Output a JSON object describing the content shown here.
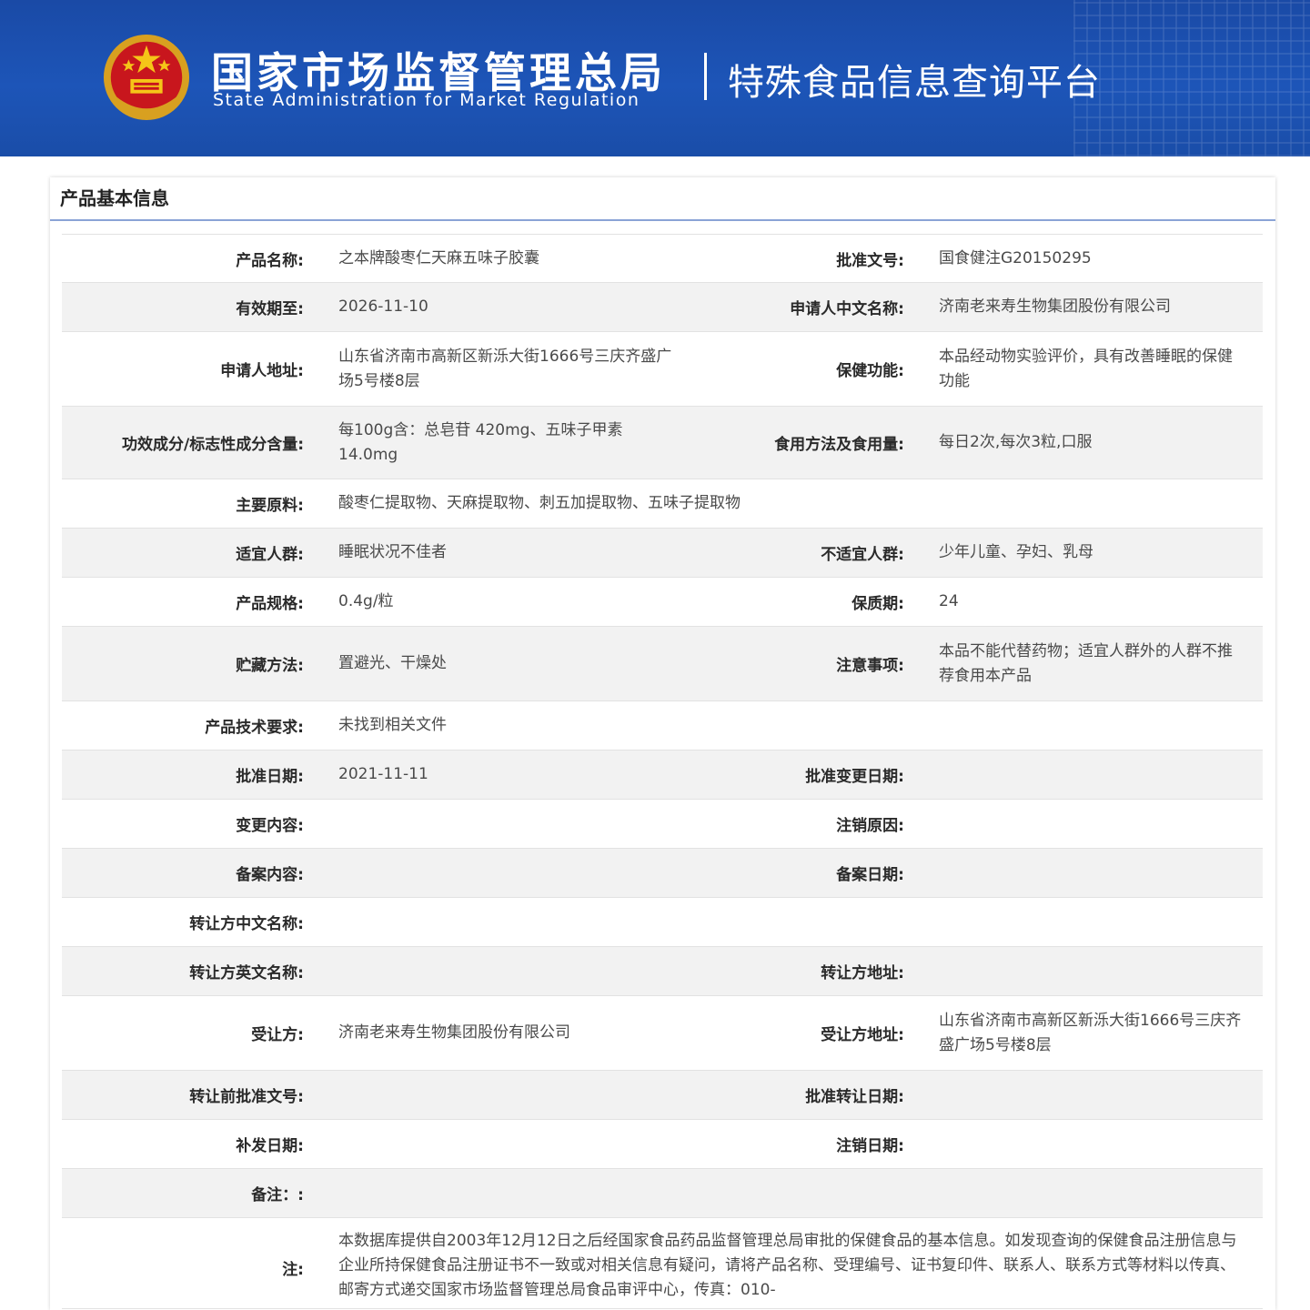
{
  "header": {
    "title_cn": "国家市场监督管理总局",
    "title_en": "State Administration  for  Market Regulation",
    "platform": "特殊食品信息查询平台"
  },
  "colors": {
    "header_bg": "#1d55b8",
    "row_alt": "#f2f2f2",
    "title_underline": "#8aa3d6"
  },
  "panel": {
    "title": "产品基本信息"
  },
  "rows": [
    {
      "l1": "产品名称:",
      "v1": "之本牌酸枣仁天麻五味子胶囊",
      "l2": "批准文号:",
      "v2": "国食健注G20150295"
    },
    {
      "l1": "有效期至:",
      "v1": "2026-11-10",
      "l2": "申请人中文名称:",
      "v2": "济南老来寿生物集团股份有限公司"
    },
    {
      "l1": "申请人地址:",
      "v1": "山东省济南市高新区新泺大街1666号三庆齐盛广场5号楼8层",
      "l2": "保健功能:",
      "v2": "本品经动物实验评价，具有改善睡眠的保健功能"
    },
    {
      "l1": "功效成分/标志性成分含量:",
      "v1": "每100g含：总皂苷 420mg、五味子甲素 14.0mg",
      "l2": "食用方法及食用量:",
      "v2": "每日2次,每次3粒,口服"
    },
    {
      "l1": "主要原料:",
      "v1": "酸枣仁提取物、天麻提取物、刺五加提取物、五味子提取物"
    },
    {
      "l1": "适宜人群:",
      "v1": "睡眠状况不佳者",
      "l2": "不适宜人群:",
      "v2": "少年儿童、孕妇、乳母"
    },
    {
      "l1": "产品规格:",
      "v1": "0.4g/粒",
      "l2": "保质期:",
      "v2": "24"
    },
    {
      "l1": "贮藏方法:",
      "v1": "置避光、干燥处",
      "l2": "注意事项:",
      "v2": "本品不能代替药物；适宜人群外的人群不推荐食用本产品"
    },
    {
      "l1": "产品技术要求:",
      "v1": "未找到相关文件"
    },
    {
      "l1": "批准日期:",
      "v1": "2021-11-11",
      "l2": "批准变更日期:",
      "v2": ""
    },
    {
      "l1": "变更内容:",
      "v1": "",
      "l2": "注销原因:",
      "v2": ""
    },
    {
      "l1": "备案内容:",
      "v1": "",
      "l2": "备案日期:",
      "v2": ""
    },
    {
      "l1": "转让方中文名称:",
      "v1": ""
    },
    {
      "l1": "转让方英文名称:",
      "v1": "",
      "l2": "转让方地址:",
      "v2": ""
    },
    {
      "l1": "受让方:",
      "v1": "济南老来寿生物集团股份有限公司",
      "l2": "受让方地址:",
      "v2": "山东省济南市高新区新泺大街1666号三庆齐盛广场5号楼8层"
    },
    {
      "l1": "转让前批准文号:",
      "v1": "",
      "l2": "批准转让日期:",
      "v2": ""
    },
    {
      "l1": "补发日期:",
      "v1": "",
      "l2": "注销日期:",
      "v2": ""
    },
    {
      "l1": "备注：:",
      "v1": ""
    },
    {
      "l1": "注:",
      "v1": "本数据库提供自2003年12月12日之后经国家食品药品监督管理总局审批的保健食品的基本信息。如发现查询的保健食品注册信息与企业所持保健食品注册证书不一致或对相关信息有疑问，请将产品名称、受理编号、证书复印件、联系人、联系方式等材料以传真、邮寄方式递交国家市场监督管理总局食品审评中心，传真：010-"
    }
  ]
}
